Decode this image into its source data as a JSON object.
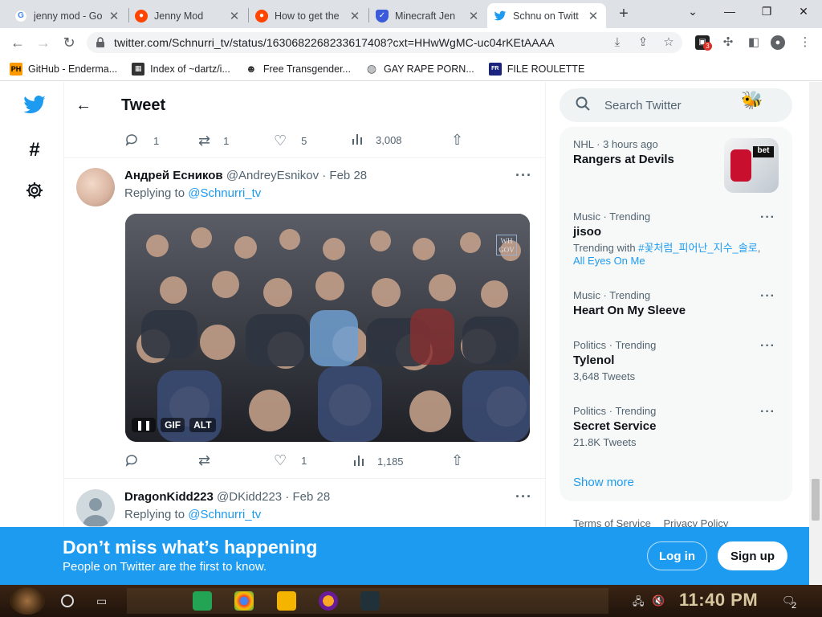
{
  "browser": {
    "tabs": [
      {
        "title": "jenny mod - Go",
        "favicon": "google-icon",
        "color": "#4285f4",
        "letter": "G"
      },
      {
        "title": "Jenny Mod",
        "favicon": "reddit-icon",
        "color": "#ff4500",
        "letter": ""
      },
      {
        "title": "How to get the",
        "favicon": "reddit-icon",
        "color": "#ff4500",
        "letter": ""
      },
      {
        "title": "Minecraft Jen",
        "favicon": "shield-icon",
        "color": "#3b5bdb",
        "letter": ""
      },
      {
        "title": "Schnu on Twitt",
        "favicon": "twitter-icon",
        "color": "#1d9bf0",
        "letter": ""
      }
    ],
    "url": "twitter.com/Schnurri_tv/status/1630682268233617408?cxt=HHwWgMC-uc04rKEtAAAA",
    "extension_badge": "3",
    "bookmarks": [
      {
        "label": "GitHub - Enderma...",
        "icon": "ph-icon"
      },
      {
        "label": "Index of ~dartz/i...",
        "icon": "qr-icon"
      },
      {
        "label": "Free Transgender...",
        "icon": "mask-icon"
      },
      {
        "label": "GAY RAPE PORN...",
        "icon": "globe-icon"
      },
      {
        "label": "FILE ROULETTE",
        "icon": "file-roulette-icon"
      }
    ]
  },
  "twitter": {
    "header_title": "Tweet",
    "top_actions": {
      "replies": "1",
      "retweets": "1",
      "likes": "5",
      "views": "3,008"
    },
    "tweet1": {
      "name": "Андрей Есников",
      "handle": "@AndreyEsnikov",
      "date": "· Feb 28",
      "replying_label": "Replying to",
      "replying_to": "@Schnurri_tv",
      "media_badges": [
        "GIF",
        "ALT"
      ],
      "watermark": "WH\nGOV",
      "actions": {
        "replies": "",
        "retweets": "",
        "likes": "1",
        "views": "1,185"
      }
    },
    "tweet2": {
      "name": "DragonKidd223",
      "handle": "@DKidd223",
      "date": "· Feb 28",
      "replying_label": "Replying to",
      "replying_to": "@Schnurri_tv"
    },
    "search_placeholder": "Search Twitter",
    "trends": [
      {
        "category": "NHL · 3 hours ago",
        "name": "Rangers at Devils",
        "sub": "",
        "has_image": true
      },
      {
        "category": "Music · Trending",
        "name": "jisoo",
        "sub_prefix": "Trending with ",
        "sub_tag": "#꽃처럼_피어난_지수_솔로",
        "sub_tag2": "All Eyes On Me"
      },
      {
        "category": "Music · Trending",
        "name": "Heart On My Sleeve",
        "sub": ""
      },
      {
        "category": "Politics · Trending",
        "name": "Tylenol",
        "sub": "3,648 Tweets"
      },
      {
        "category": "Politics · Trending",
        "name": "Secret Service",
        "sub": "21.8K Tweets"
      }
    ],
    "show_more": "Show more",
    "footer_links": [
      "Terms of Service",
      "Privacy Policy"
    ],
    "banner": {
      "heading": "Don’t miss what’s happening",
      "subtext": "People on Twitter are the first to know.",
      "login": "Log in",
      "signup": "Sign up"
    }
  },
  "taskbar": {
    "clock": "11:40 PM",
    "notification_count": "2"
  },
  "colors": {
    "twitter_blue": "#1d9bf0",
    "text_secondary": "#536471"
  }
}
